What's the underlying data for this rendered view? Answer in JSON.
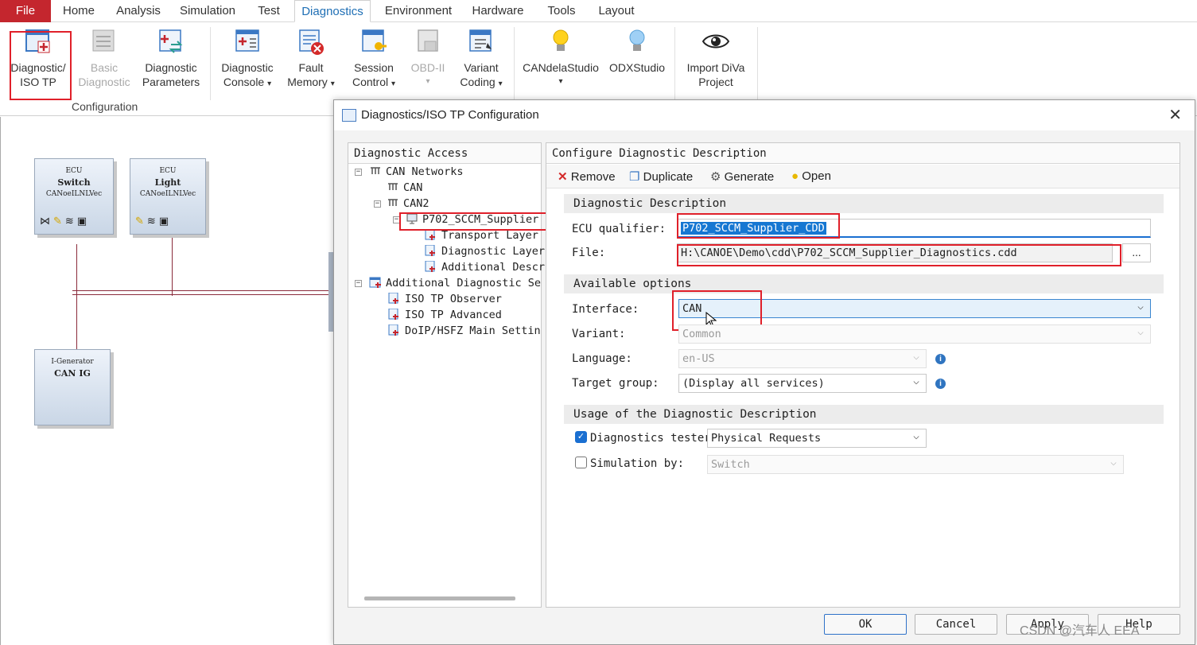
{
  "tabs": {
    "file": "File",
    "home": "Home",
    "analysis": "Analysis",
    "simulation": "Simulation",
    "test": "Test",
    "diagnostics": "Diagnostics",
    "environment": "Environment",
    "hardware": "Hardware",
    "tools": "Tools",
    "layout": "Layout"
  },
  "ribbon": {
    "diag_iso_tp_1": "Diagnostic/",
    "diag_iso_tp_2": "ISO TP",
    "basic_diag_1": "Basic",
    "basic_diag_2": "Diagnostic",
    "diag_params_1": "Diagnostic",
    "diag_params_2": "Parameters",
    "configuration_group": "Configuration",
    "diag_console_1": "Diagnostic",
    "diag_console_2": "Console",
    "fault_memory_1": "Fault",
    "fault_memory_2": "Memory",
    "session_control_1": "Session",
    "session_control_2": "Control",
    "obd_1": "OBD-II",
    "variant_coding_1": "Variant",
    "variant_coding_2": "Coding",
    "candela": "CANdelaStudio",
    "odx": "ODXStudio",
    "import_diva_1": "Import DiVa",
    "import_diva_2": "Project",
    "dropdown_arrow": "▾"
  },
  "canvas": {
    "ecu_switch": {
      "t1": "ECU",
      "t2": "Switch",
      "t3": "CANoeILNLVec"
    },
    "ecu_light": {
      "t1": "ECU",
      "t2": "Light",
      "t3": "CANoeILNLVec"
    },
    "igen": {
      "t1": "I-Generator",
      "t2": "CAN IG"
    }
  },
  "dialog": {
    "title": "Diagnostics/ISO TP Configuration",
    "close": "✕",
    "left_header": "Diagnostic Access",
    "tree": {
      "can_networks": "CAN Networks",
      "can": "CAN",
      "can2": "CAN2",
      "p702": "P702_SCCM_Supplier",
      "transport_layer": "Transport Layer",
      "diagnostic_layer": "Diagnostic Layer",
      "additional_desc": "Additional Descr",
      "additional_diag": "Additional Diagnostic Se",
      "iso_tp_observer": "ISO TP Observer",
      "iso_tp_advanced": "ISO TP Advanced",
      "doip": "DoIP/HSFZ Main Settin"
    },
    "right_header": "Configure Diagnostic Description",
    "toolbar": {
      "remove": "Remove",
      "duplicate": "Duplicate",
      "generate": "Generate",
      "open": "Open"
    },
    "section_desc": "Diagnostic Description",
    "ecu_qualifier_label": "ECU qualifier:",
    "ecu_qualifier_value": "P702_SCCM_Supplier_CDD",
    "file_label": "File:",
    "file_value": "H:\\CANOE\\Demo\\cdd\\P702_SCCM_Supplier_Diagnostics.cdd",
    "browse": "...",
    "section_options": "Available options",
    "interface_label": "Interface:",
    "interface_value": "CAN",
    "variant_label": "Variant:",
    "variant_value": "Common",
    "language_label": "Language:",
    "language_value": "en-US",
    "target_label": "Target group:",
    "target_value": "(Display all services)",
    "section_usage": "Usage of the Diagnostic Description",
    "diag_tester_label": "Diagnostics tester",
    "diag_tester_value": "Physical Requests",
    "simulation_label": "Simulation by:",
    "simulation_value": "Switch",
    "ok": "OK",
    "cancel": "Cancel",
    "apply": "Apply",
    "help": "Help"
  },
  "watermark": "CSDN @汽车人    EEA",
  "colors": {
    "file_tab": "#c4262e",
    "highlight_box": "#e0202a",
    "selection": "#1677d2"
  }
}
